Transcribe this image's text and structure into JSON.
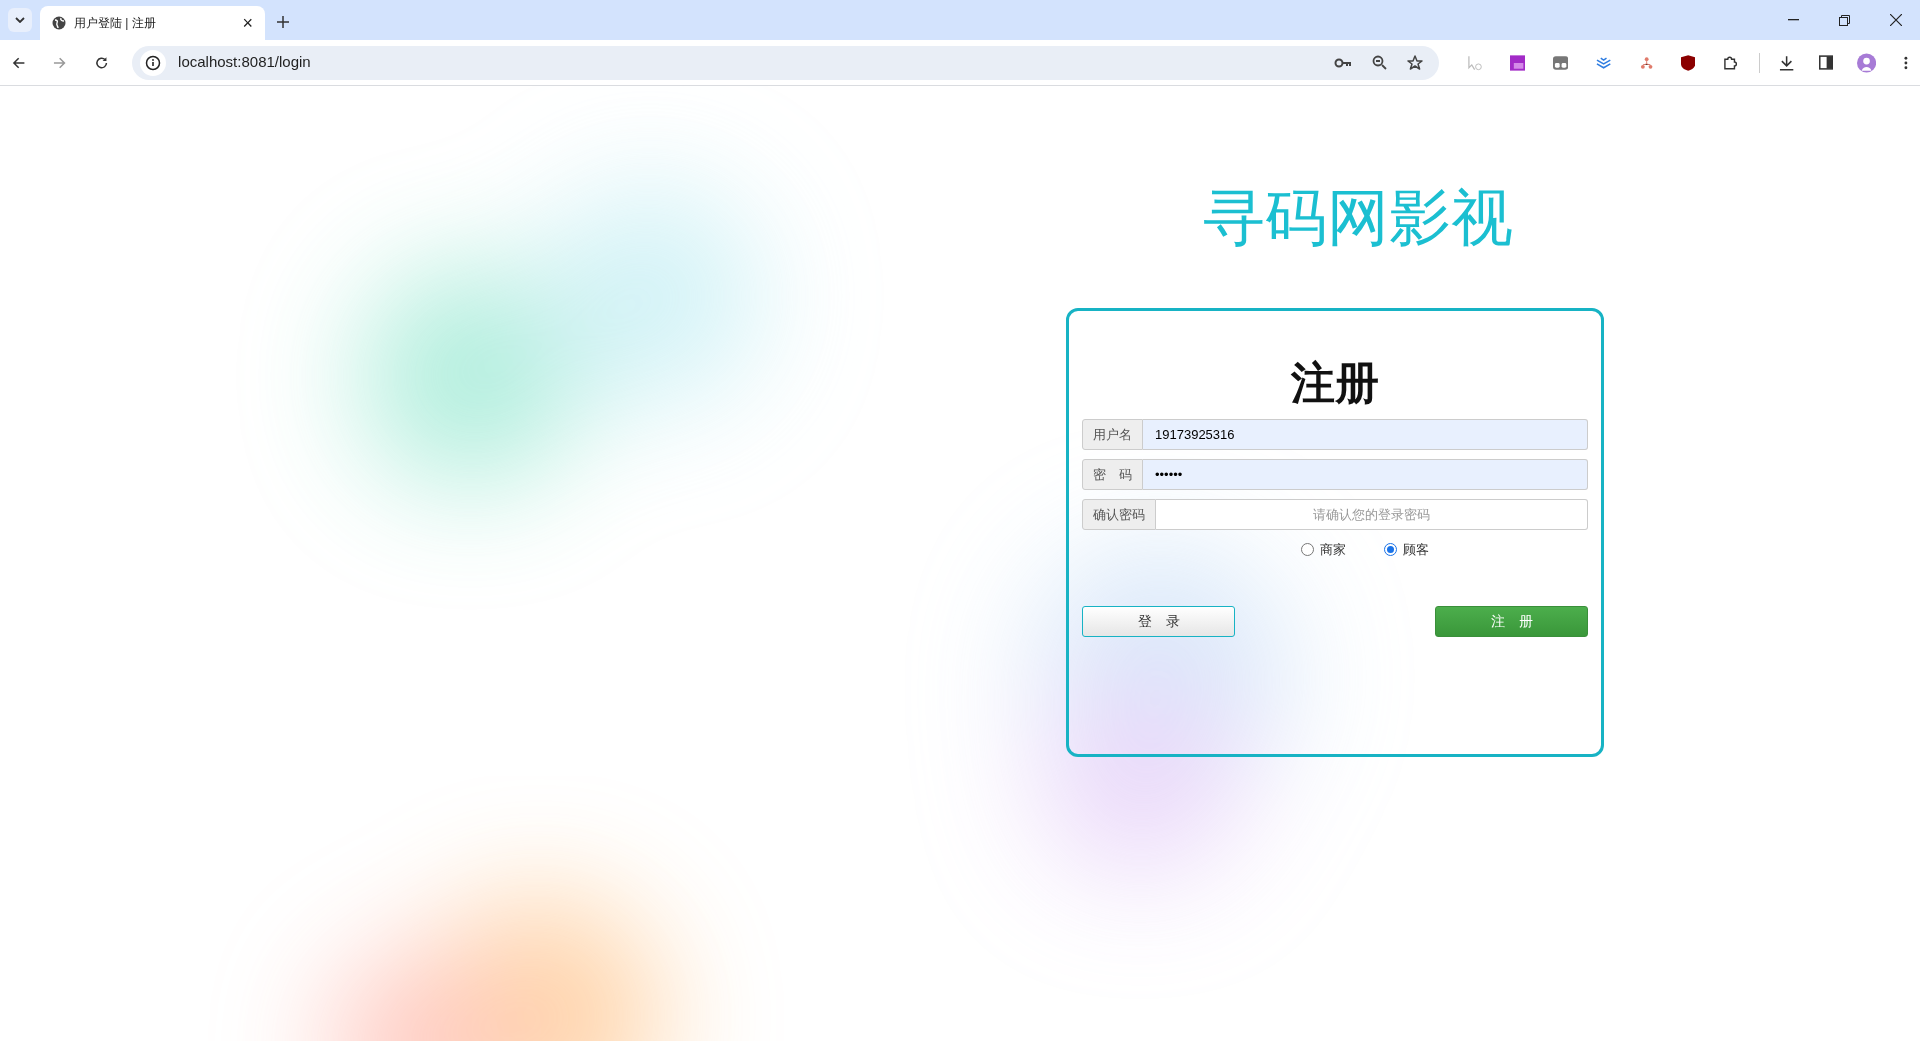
{
  "browser": {
    "tab": {
      "title": "用户登陆 | 注册",
      "close": "×"
    },
    "address": "localhost:8081/login"
  },
  "page": {
    "brand": "寻码网影视",
    "form": {
      "heading": "注册",
      "fields": [
        {
          "label": "用户名",
          "value": "19173925316",
          "autofilled": true
        },
        {
          "label": "密　码",
          "value": "••••••",
          "autofilled": true
        },
        {
          "label": "确认密码",
          "placeholder": "请确认您的登录密码",
          "autofilled": false
        }
      ],
      "roles": [
        {
          "label": "商家",
          "selected": false
        },
        {
          "label": "顾客",
          "selected": true
        }
      ],
      "buttons": [
        {
          "label": "登　录",
          "kind": "secondary"
        },
        {
          "label": "注　册",
          "kind": "primary"
        }
      ]
    }
  }
}
